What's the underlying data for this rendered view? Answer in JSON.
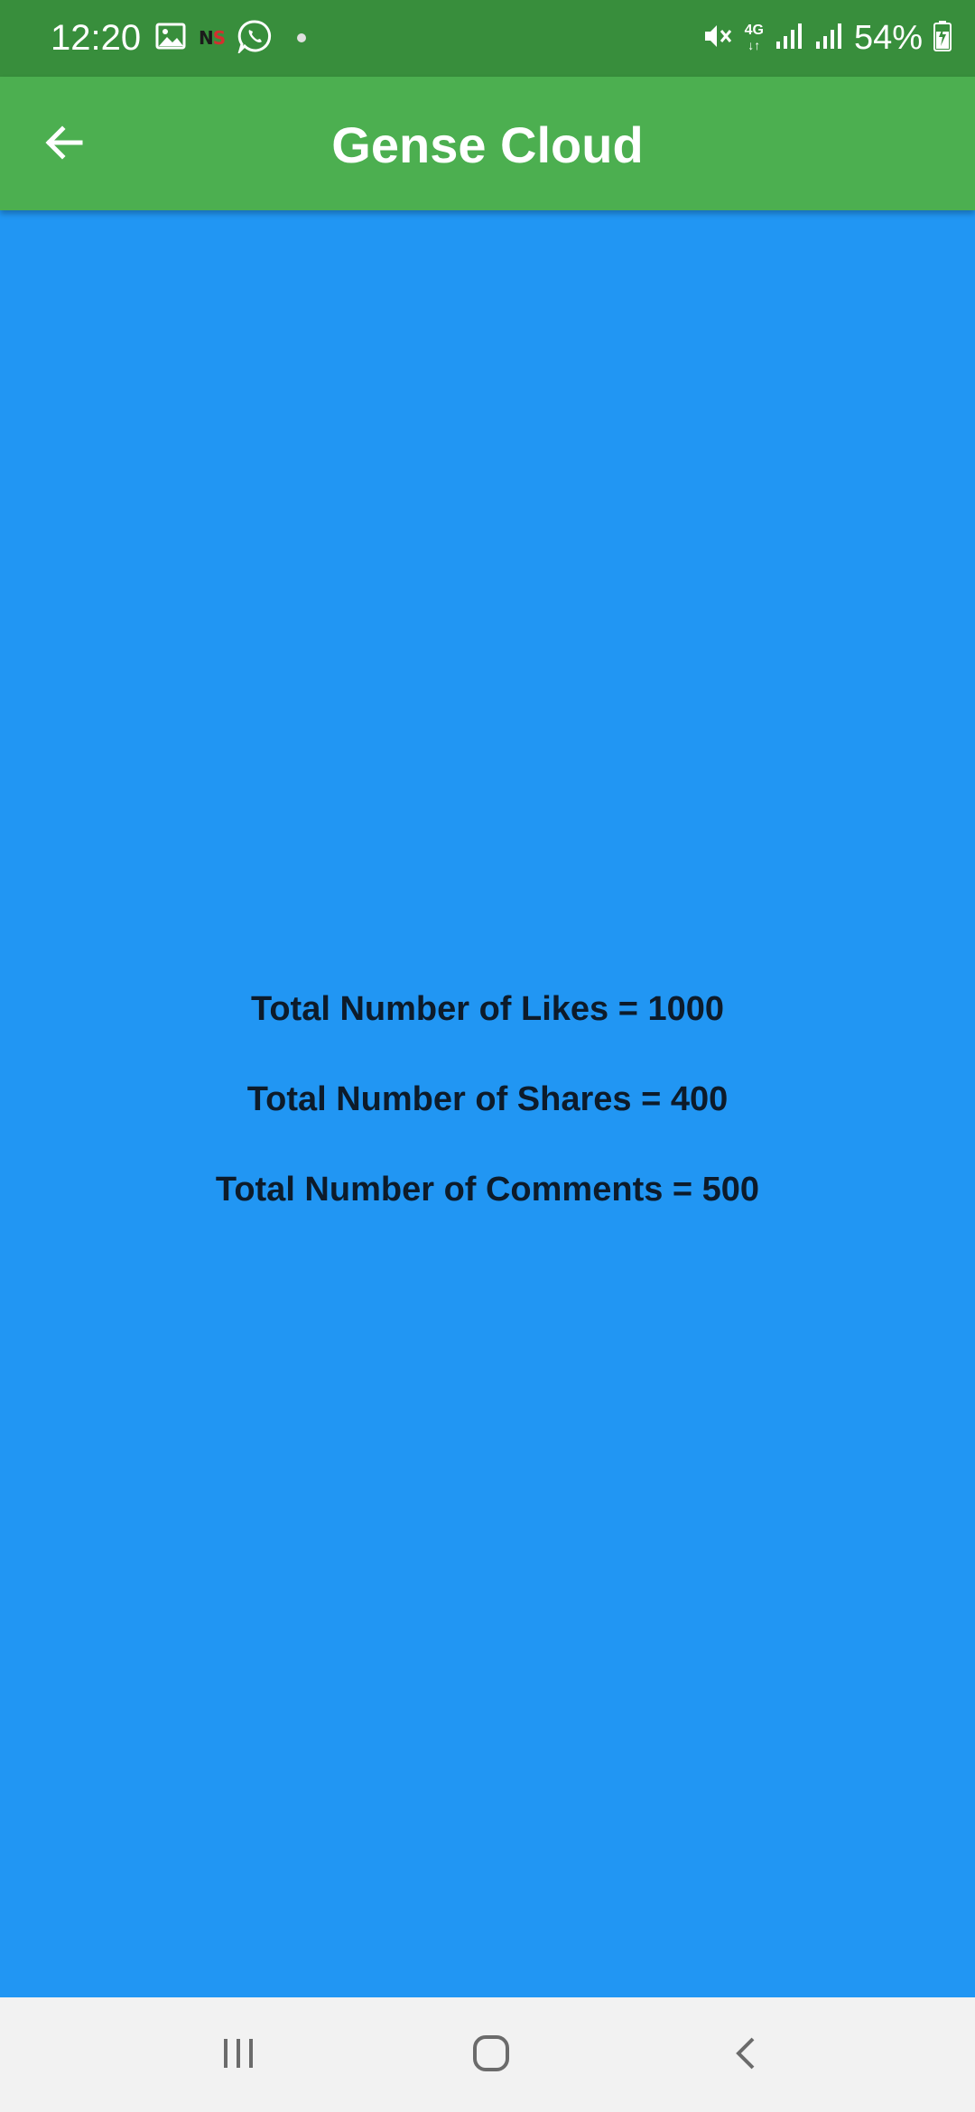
{
  "status_bar": {
    "time": "12:20",
    "network_label_top": "4G",
    "network_label_bottom": "↓↑",
    "battery": "54%",
    "icons": [
      "gallery-icon",
      "ns-icon",
      "whatsapp-icon",
      "dot-icon",
      "mute-icon",
      "signal-icon",
      "signal-icon",
      "battery-charging-icon"
    ],
    "ns_text_n": "N",
    "ns_text_s": "S",
    "color": "#388E3C"
  },
  "app_bar": {
    "title": "Gense Cloud",
    "back_icon": "arrow-left-icon",
    "color": "#4CAF50"
  },
  "content": {
    "background": "#2196F3",
    "stats": [
      "Total Number of Likes = 1000",
      "Total Number of Shares = 400",
      "Total Number of Comments = 500"
    ]
  },
  "nav_bar": {
    "icons": [
      "recents-icon",
      "home-icon",
      "back-icon"
    ]
  }
}
